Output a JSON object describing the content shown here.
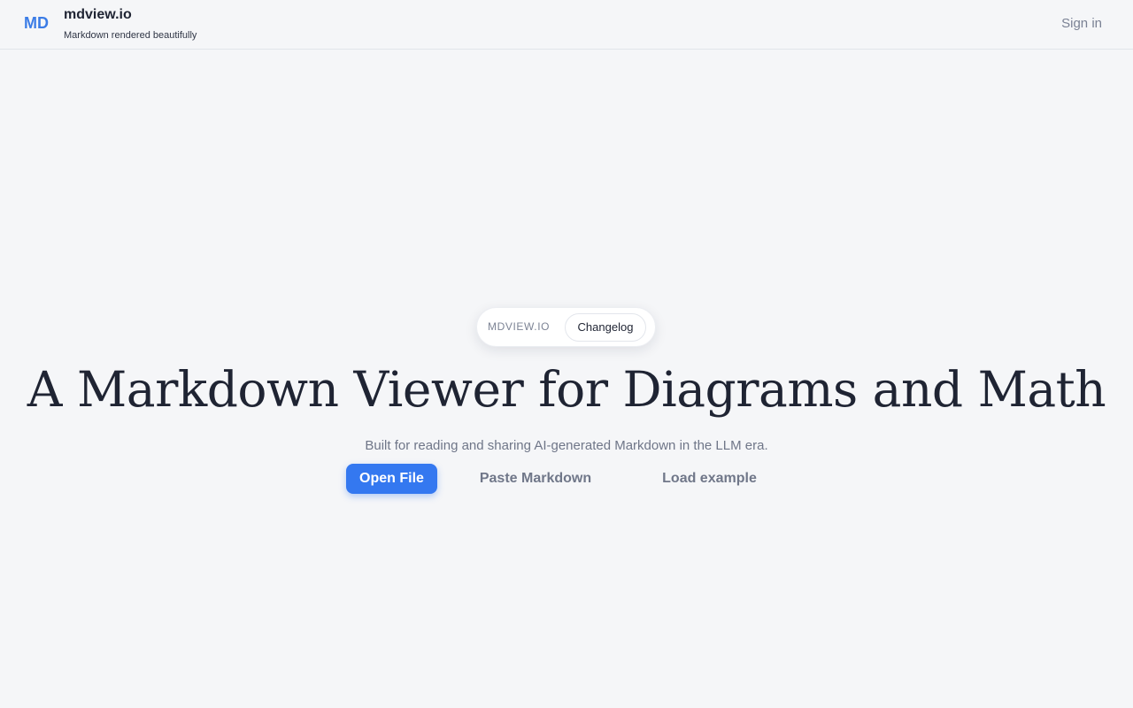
{
  "header": {
    "logo_mark": "MD",
    "title": "mdview.io",
    "tagline": "Markdown rendered beautifully",
    "sign_in_label": "Sign in"
  },
  "announcement": {
    "label": "MDVIEW.IO",
    "button_label": "Changelog"
  },
  "hero": {
    "title": "A Markdown Viewer for Diagrams and Math",
    "subtitle": "Built for reading and sharing AI-generated Markdown in the LLM era."
  },
  "actions": {
    "open_file_label": "Open File",
    "paste_markdown_label": "Paste Markdown",
    "load_example_label": "Load example"
  },
  "colors": {
    "accent": "#3478f0",
    "logo": "#3b7ce6",
    "background": "#f5f6f8",
    "text": "#1f2433",
    "muted_text": "#707789"
  }
}
